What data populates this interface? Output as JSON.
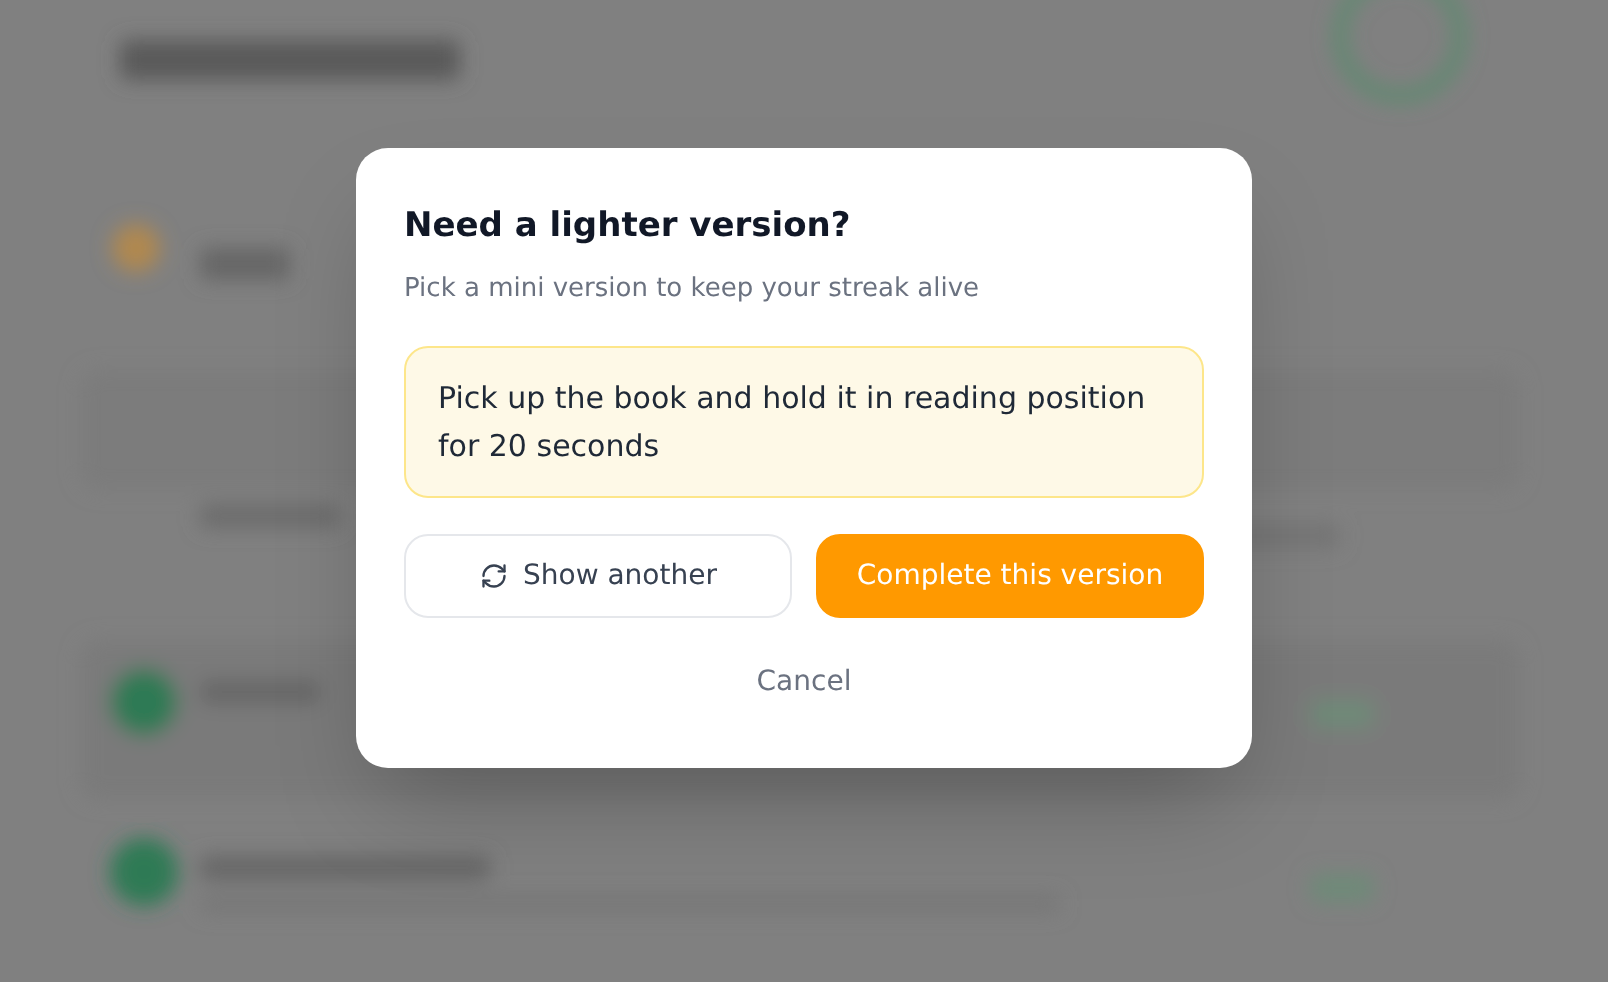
{
  "dialog": {
    "title": "Need a lighter version?",
    "subtitle": "Pick a mini version to keep your streak alive",
    "suggestion": "Pick up the book and hold it in reading position for 20 seconds",
    "buttons": [
      {
        "kind": "secondary",
        "label": "Show another"
      },
      {
        "kind": "primary",
        "label": "Complete this version"
      }
    ],
    "cancel": "Cancel"
  }
}
